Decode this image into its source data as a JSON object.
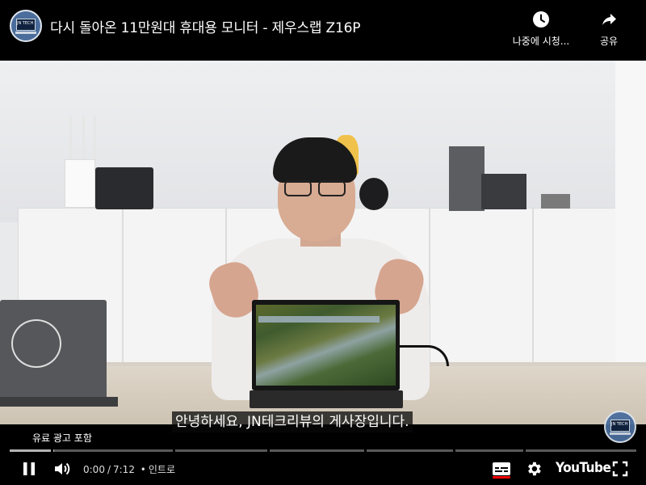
{
  "header": {
    "title": "다시 돌아온 11만원대 휴대용 모니터 - 제우스랩 Z16P",
    "channel_avatar_text": "JN TECH",
    "actions": [
      {
        "icon": "clock-icon",
        "label": "나중에 시청..."
      },
      {
        "icon": "share-icon",
        "label": "공유"
      }
    ]
  },
  "video": {
    "caption": "안녕하세요, JN테크리뷰의 게사장입니다.",
    "ad_label": "유료 광고 포함",
    "watermark_text": "JN TECH"
  },
  "progress": {
    "played_fraction": 0.0,
    "loaded_fraction": 0.07,
    "chapters": 7
  },
  "controls": {
    "current_time": "0:00",
    "separator": "/",
    "duration": "7:12",
    "chapter_dot": "•",
    "chapter_title": "인트로",
    "logo": "YouTube",
    "accent_color": "#ff0000",
    "icons": [
      "pause-icon",
      "volume-icon",
      "subtitles-icon",
      "gear-icon",
      "fullscreen-icon"
    ]
  }
}
